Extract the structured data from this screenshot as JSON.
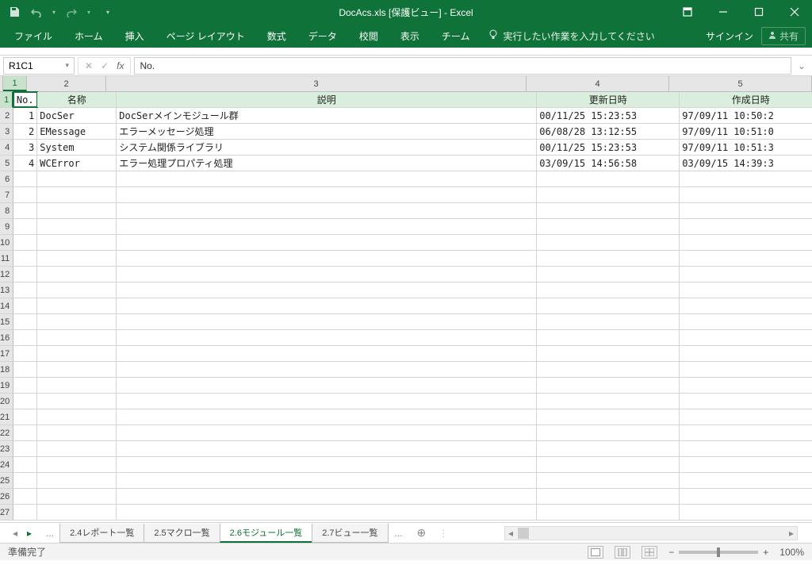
{
  "title": "DocAcs.xls  [保護ビュー] - Excel",
  "qat": {
    "save": "save-icon",
    "undo": "undo-icon",
    "redo": "redo-icon"
  },
  "ribbon": {
    "tabs": [
      "ファイル",
      "ホーム",
      "挿入",
      "ページ レイアウト",
      "数式",
      "データ",
      "校閲",
      "表示",
      "チーム"
    ],
    "tellme": "実行したい作業を入力してください",
    "signin": "サインイン",
    "share": "共有"
  },
  "namebox": "R1C1",
  "formula": "No.",
  "columns": [
    {
      "num": "1",
      "w": "c1"
    },
    {
      "num": "2",
      "w": "c2"
    },
    {
      "num": "3",
      "w": "c3"
    },
    {
      "num": "4",
      "w": "c4"
    },
    {
      "num": "5",
      "w": "c5"
    }
  ],
  "header_row": [
    "No.",
    "名称",
    "説明",
    "更新日時",
    "作成日時"
  ],
  "data_rows": [
    [
      "1",
      "DocSer",
      "DocSerメインモジュール群",
      "00/11/25 15:23:53",
      "97/09/11 10:50:2"
    ],
    [
      "2",
      "EMessage",
      "エラーメッセージ処理",
      "06/08/28 13:12:55",
      "97/09/11 10:51:0"
    ],
    [
      "3",
      "System",
      "システム関係ライブラリ",
      "00/11/25 15:23:53",
      "97/09/11 10:51:3"
    ],
    [
      "4",
      "WCError",
      "エラー処理プロパティ処理",
      "03/09/15 14:56:58",
      "03/09/15 14:39:3"
    ]
  ],
  "empty_rows": 22,
  "sheets": {
    "ellipsis": "...",
    "tabs": [
      "2.4レポート一覧",
      "2.5マクロ一覧",
      "2.6モジュール一覧",
      "2.7ビュー一覧"
    ],
    "active": 2
  },
  "status": {
    "left": "準備完了",
    "zoom": "100%",
    "minus": "−",
    "plus": "+"
  }
}
